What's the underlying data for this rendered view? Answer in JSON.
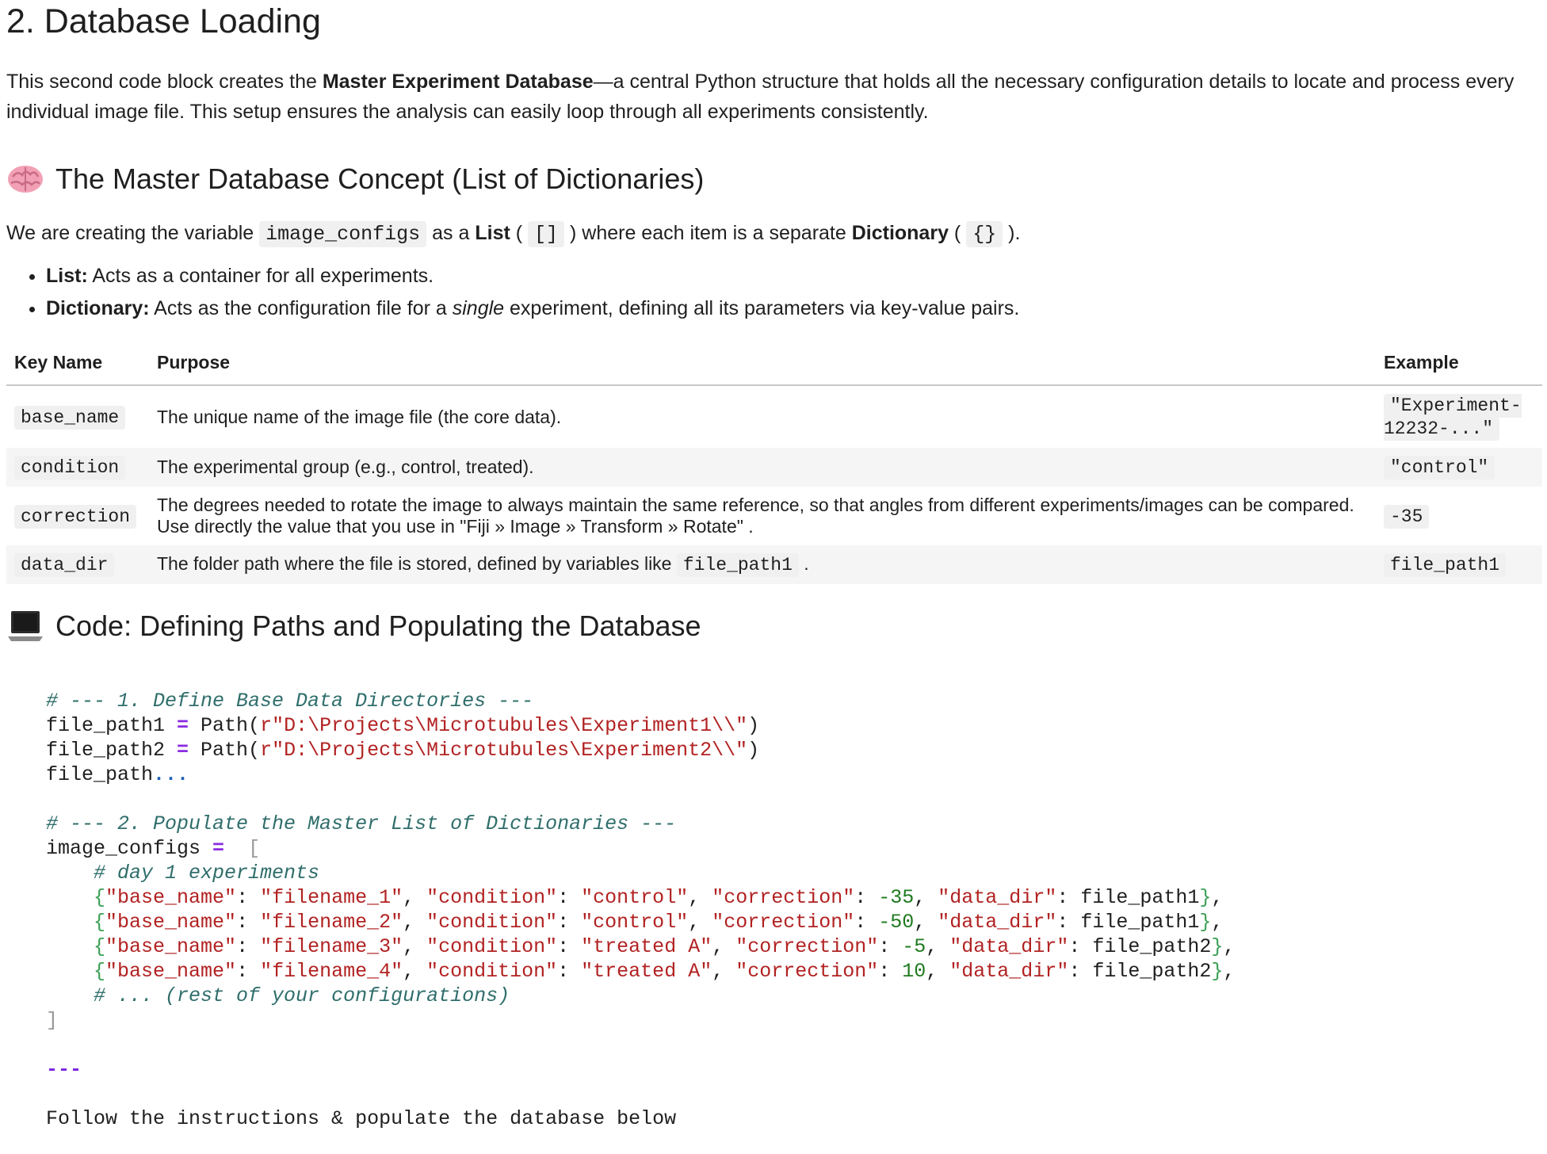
{
  "heading": "2. Database Loading",
  "intro": {
    "before": "This second code block creates the ",
    "bold": "Master Experiment Database",
    "after": "—a central Python structure that holds all the necessary configuration details to locate and process every individual image file. This setup ensures the analysis can easily loop through all experiments consistently."
  },
  "concept": {
    "icon": "brain-icon",
    "title": "The Master Database Concept (List of Dictionaries)",
    "p1": "We are creating the variable ",
    "var": "image_configs",
    "p2": " as a ",
    "list_word": "List",
    "p3": " ( ",
    "list_sym": "[]",
    "p4": " ) where each item is a separate ",
    "dict_word": "Dictionary",
    "p5": " ( ",
    "dict_sym": "{}",
    "p6": " ).",
    "bullets": [
      {
        "label": "List:",
        "text": " Acts as a container for all experiments."
      },
      {
        "label": "Dictionary:",
        "text_before": " Acts as the configuration file for a ",
        "em": "single",
        "text_after": " experiment, defining all its parameters via key-value pairs."
      }
    ]
  },
  "table": {
    "headers": [
      "Key Name",
      "Purpose",
      "Example"
    ],
    "rows": [
      {
        "key": "base_name",
        "purpose": "The unique name of the image file (the core data).",
        "example": "\"Experiment-12232-...\""
      },
      {
        "key": "condition",
        "purpose": "The experimental group (e.g., control, treated).",
        "example": "\"control\""
      },
      {
        "key": "correction",
        "purpose": "The degrees needed to rotate the image to always maintain the same reference, so that angles from different experiments/images can be compared. Use directly the value that you use in \"Fiji » Image » Transform » Rotate\" .",
        "example": "-35"
      },
      {
        "key": "data_dir",
        "purpose_before": "The folder path where the file is stored, defined by variables like ",
        "purpose_code": "file_path1",
        "purpose_after": " .",
        "example": "file_path1"
      }
    ]
  },
  "code_section": {
    "icon": "laptop-icon",
    "title": "Code: Defining Paths and Populating the Database"
  },
  "code": {
    "c1": "# --- 1. Define Base Data Directories ---",
    "fp1_var": "file_path1 ",
    "fp1_call": " Path(",
    "fp1_str": "r\"D:\\Projects\\Microtubules\\Experiment1\\\\\"",
    "fp2_var": "file_path2 ",
    "fp2_str": "r\"D:\\Projects\\Microtubules\\Experiment2\\\\\"",
    "fp3": "file_path",
    "ellipsis": "...",
    "c2": "# --- 2. Populate the Master List of Dictionaries ---",
    "ic_var": "image_configs ",
    "c3": "# day 1 experiments",
    "entries": [
      {
        "name": "\"filename_1\"",
        "cond": "\"control\"",
        "corr": "-35",
        "dir": "file_path1",
        "corr_sep": ": "
      },
      {
        "name": "\"filename_2\"",
        "cond": "\"control\"",
        "corr": "-50",
        "dir": "file_path1",
        "corr_sep": ": "
      },
      {
        "name": "\"filename_3\"",
        "cond": "\"treated A\"",
        "corr": "-5",
        "dir": "file_path2",
        "corr_sep": ": "
      },
      {
        "name": "\"filename_4\"",
        "cond": "\"treated A\"",
        "corr": "10",
        "dir": "file_path2",
        "corr_sep": ": "
      }
    ],
    "c4": "# ... (rest of your configurations)",
    "hr": "---",
    "follow": "Follow the instructions & populate the database below"
  }
}
